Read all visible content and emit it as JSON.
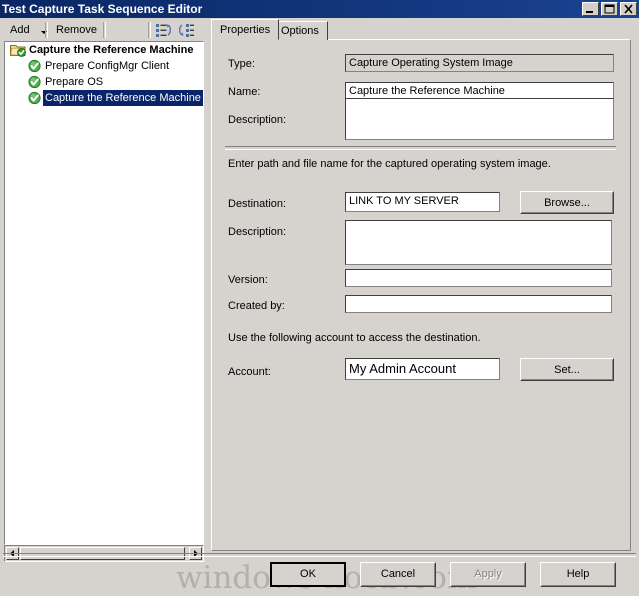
{
  "window": {
    "title": "Test Capture Task Sequence Editor",
    "controls": {
      "minimize": "minimize-button",
      "maximize": "maximize-button",
      "close": "close-button"
    }
  },
  "toolbar": {
    "add_label": "Add",
    "remove_label": "Remove",
    "move_up_icon": "move-up-icon",
    "move_down_icon": "move-down-icon"
  },
  "tree": {
    "root": {
      "label": "Capture the Reference Machine",
      "icon": "folder-checked-icon"
    },
    "items": [
      {
        "label": "Prepare ConfigMgr Client",
        "icon": "green-check-icon",
        "selected": false
      },
      {
        "label": "Prepare OS",
        "icon": "green-check-icon",
        "selected": false
      },
      {
        "label": "Capture the Reference Machine",
        "icon": "green-check-icon",
        "selected": true
      }
    ],
    "scrollbar": {
      "left_arrow": "scroll-left-arrow",
      "right_arrow": "scroll-right-arrow"
    }
  },
  "tabs": [
    {
      "label": "Properties",
      "active": true
    },
    {
      "label": "Options",
      "active": false
    }
  ],
  "form": {
    "type": {
      "label": "Type:",
      "value": "Capture Operating System Image",
      "readonly": true
    },
    "name": {
      "label": "Name:",
      "value": "Capture the Reference Machine",
      "readonly": false
    },
    "description_top": {
      "label": "Description:",
      "value": "",
      "readonly": false
    },
    "section_destination": "Enter path and file name for the captured operating system image.",
    "destination": {
      "label": "Destination:",
      "value": "LINK TO MY SERVER",
      "readonly": false
    },
    "browse_button": "Browse...",
    "description_image": {
      "label": "Description:",
      "value": "",
      "readonly": false
    },
    "version": {
      "label": "Version:",
      "value": "",
      "readonly": false
    },
    "created_by": {
      "label": "Created by:",
      "value": "",
      "readonly": false
    },
    "section_account": "Use the following account to access the destination.",
    "account": {
      "label": "Account:",
      "value": "My Admin Account",
      "readonly": false
    },
    "set_button": "Set..."
  },
  "buttons": {
    "ok": "OK",
    "cancel": "Cancel",
    "apply": "Apply",
    "help": "Help"
  },
  "watermark": "windows-noob.com",
  "colors": {
    "title_bar": "#0a2764",
    "face": "#d6d3ce",
    "selection": "#0a246a",
    "check_green": "#2e9b2e",
    "disabled_text": "#848284"
  }
}
